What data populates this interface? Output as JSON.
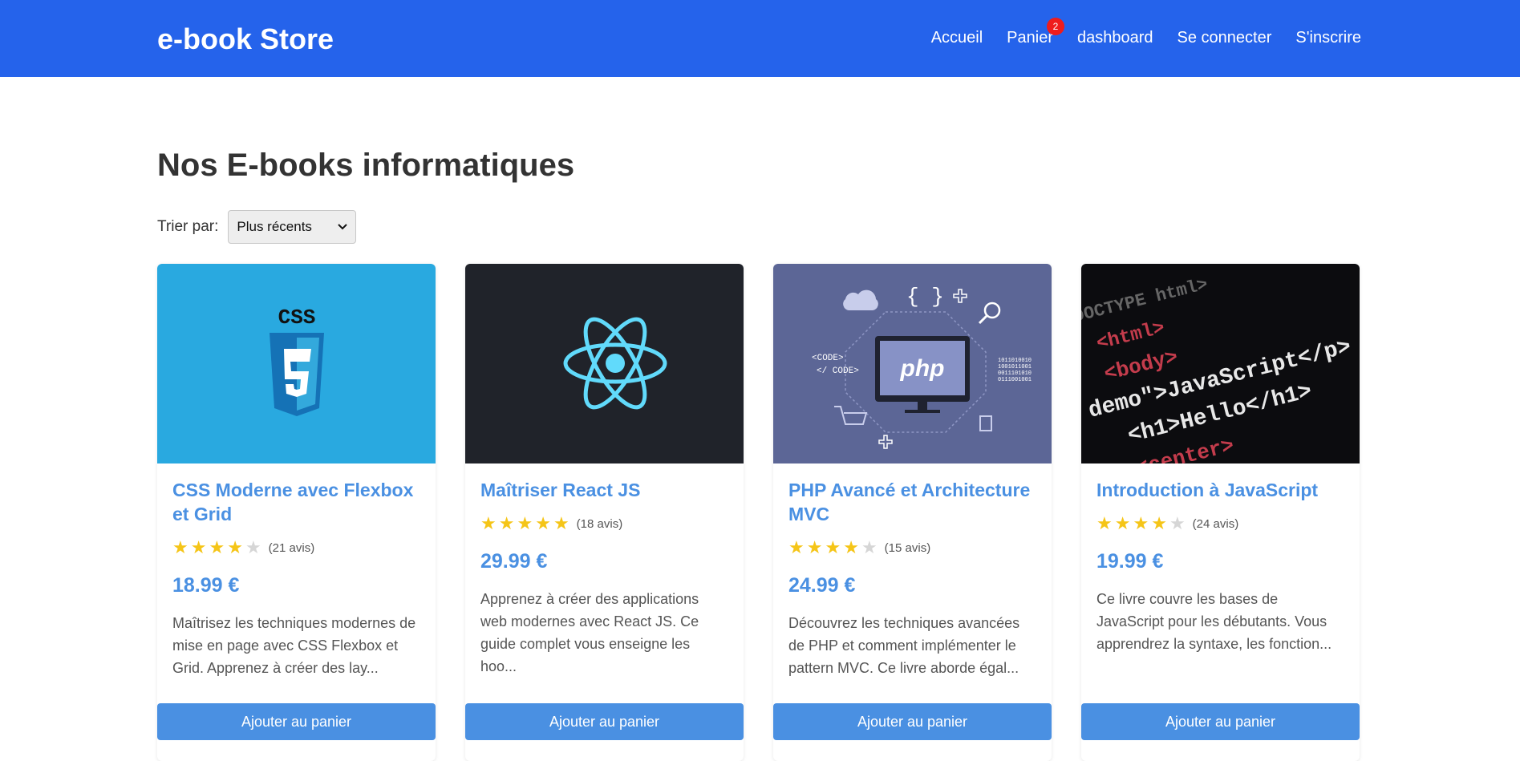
{
  "header": {
    "brand": "e-book Store",
    "nav": [
      "Accueil",
      "Panier",
      "dashboard",
      "Se connecter",
      "S'inscrire"
    ],
    "cart_count": "2"
  },
  "main": {
    "title": "Nos E-books informatiques",
    "sort_label": "Trier par:",
    "sort_value": "Plus récents"
  },
  "books": [
    {
      "title": "CSS Moderne avec Flexbox et Grid",
      "rating": 4,
      "reviews": "(21 avis)",
      "price": "18.99 €",
      "description": "Maîtrisez les techniques modernes de mise en page avec CSS Flexbox et Grid. Apprenez à créer des lay...",
      "button": "Ajouter au panier",
      "cover_text": "CSS",
      "cover_color": "#29a9e0"
    },
    {
      "title": "Maîtriser React JS",
      "rating": 5,
      "reviews": "(18 avis)",
      "price": "29.99 €",
      "description": "Apprenez à créer des applications web modernes avec React JS. Ce guide complet vous enseigne les hoo...",
      "button": "Ajouter au panier",
      "cover_color": "#20232a"
    },
    {
      "title": "PHP Avancé et Architecture MVC",
      "rating": 4,
      "reviews": "(15 avis)",
      "price": "24.99 €",
      "description": "Découvrez les techniques avancées de PHP et comment implémenter le pattern MVC. Ce livre aborde égal...",
      "button": "Ajouter au panier",
      "cover_text": "php",
      "cover_code_open": "<CODE>",
      "cover_code_close": "</ CODE>",
      "cover_binary": [
        "1011010010",
        "1001011001",
        "0011101010",
        "0111001001"
      ],
      "cover_color": "#5c6696"
    },
    {
      "title": "Introduction à JavaScript",
      "rating": 4,
      "reviews": "(24 avis)",
      "price": "19.99 €",
      "description": "Ce livre couvre les bases de JavaScript pour les débutants. Vous apprendrez la syntaxe, les fonction...",
      "button": "Ajouter au panier",
      "cover_lines": [
        "DOCTYPE html>",
        "<html>",
        "<body>",
        "demo\">JavaScript</p>",
        "<h1>Hello</h1>",
        "<center>"
      ],
      "cover_color": "#0c0c0f"
    }
  ],
  "colors": {
    "header_bg": "#2563eb",
    "accent": "#4a90e2",
    "star": "#f5c518",
    "badge": "#ef1c1c"
  },
  "icons": [
    "chevron-down-icon",
    "css3-logo-icon",
    "react-logo-icon",
    "star-icon"
  ]
}
